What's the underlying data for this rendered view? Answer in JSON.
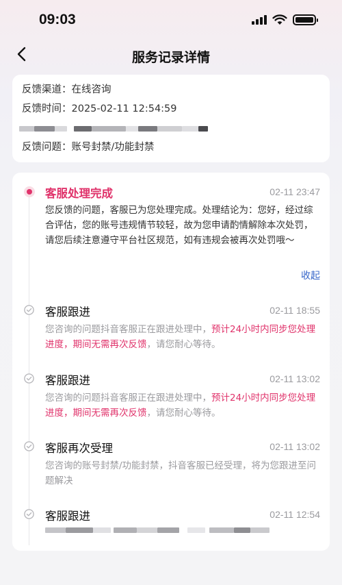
{
  "status_bar": {
    "time": "09:03",
    "icons": [
      "cellular-signal-icon",
      "wifi-icon",
      "battery-icon"
    ]
  },
  "nav": {
    "back_icon": "chevron-left-icon",
    "title": "服务记录详情"
  },
  "info": {
    "channel_label": "反馈渠道：",
    "channel_value": "在线咨询",
    "time_label": "反馈时间：",
    "time_value": "2025-02-11 12:54:59",
    "issue_label": "反馈问题：",
    "issue_value": "账号封禁/功能封禁"
  },
  "timeline": {
    "collapse_label": "收起",
    "entries": [
      {
        "title": "客服处理完成",
        "time": "02-11 23:47",
        "body": "您反馈的问题，客服已为您处理完成。处理结论为：您好，经过综合评估，您的账号违规情节较轻，故为您申请酌情解除本次处罚，请您后续注意遵守平台社区规范，如有违规会被再次处罚哦～"
      },
      {
        "title": "客服跟进",
        "time": "02-11 18:55",
        "body_a": "您咨询的问题抖音客服正在跟进处理中，",
        "body_hl": "预计24小时内同步您处理进度，期间无需再次反馈",
        "body_b": "，请您耐心等待。"
      },
      {
        "title": "客服跟进",
        "time": "02-11 13:02",
        "body_a": "您咨询的问题抖音客服正在跟进处理中，",
        "body_hl": "预计24小时内同步您处理进度，期间无需再次反馈",
        "body_b": "，请您耐心等待。"
      },
      {
        "title": "客服再次受理",
        "time": "02-11 13:02",
        "body": "您咨询的账号封禁/功能封禁，抖音客服已经受理，将为您跟进至问题解决"
      },
      {
        "title": "客服跟进",
        "time": "02-11 12:54"
      }
    ]
  },
  "colors": {
    "accent": "#e0336b",
    "link": "#3565c9",
    "muted": "#9a9a9e"
  }
}
